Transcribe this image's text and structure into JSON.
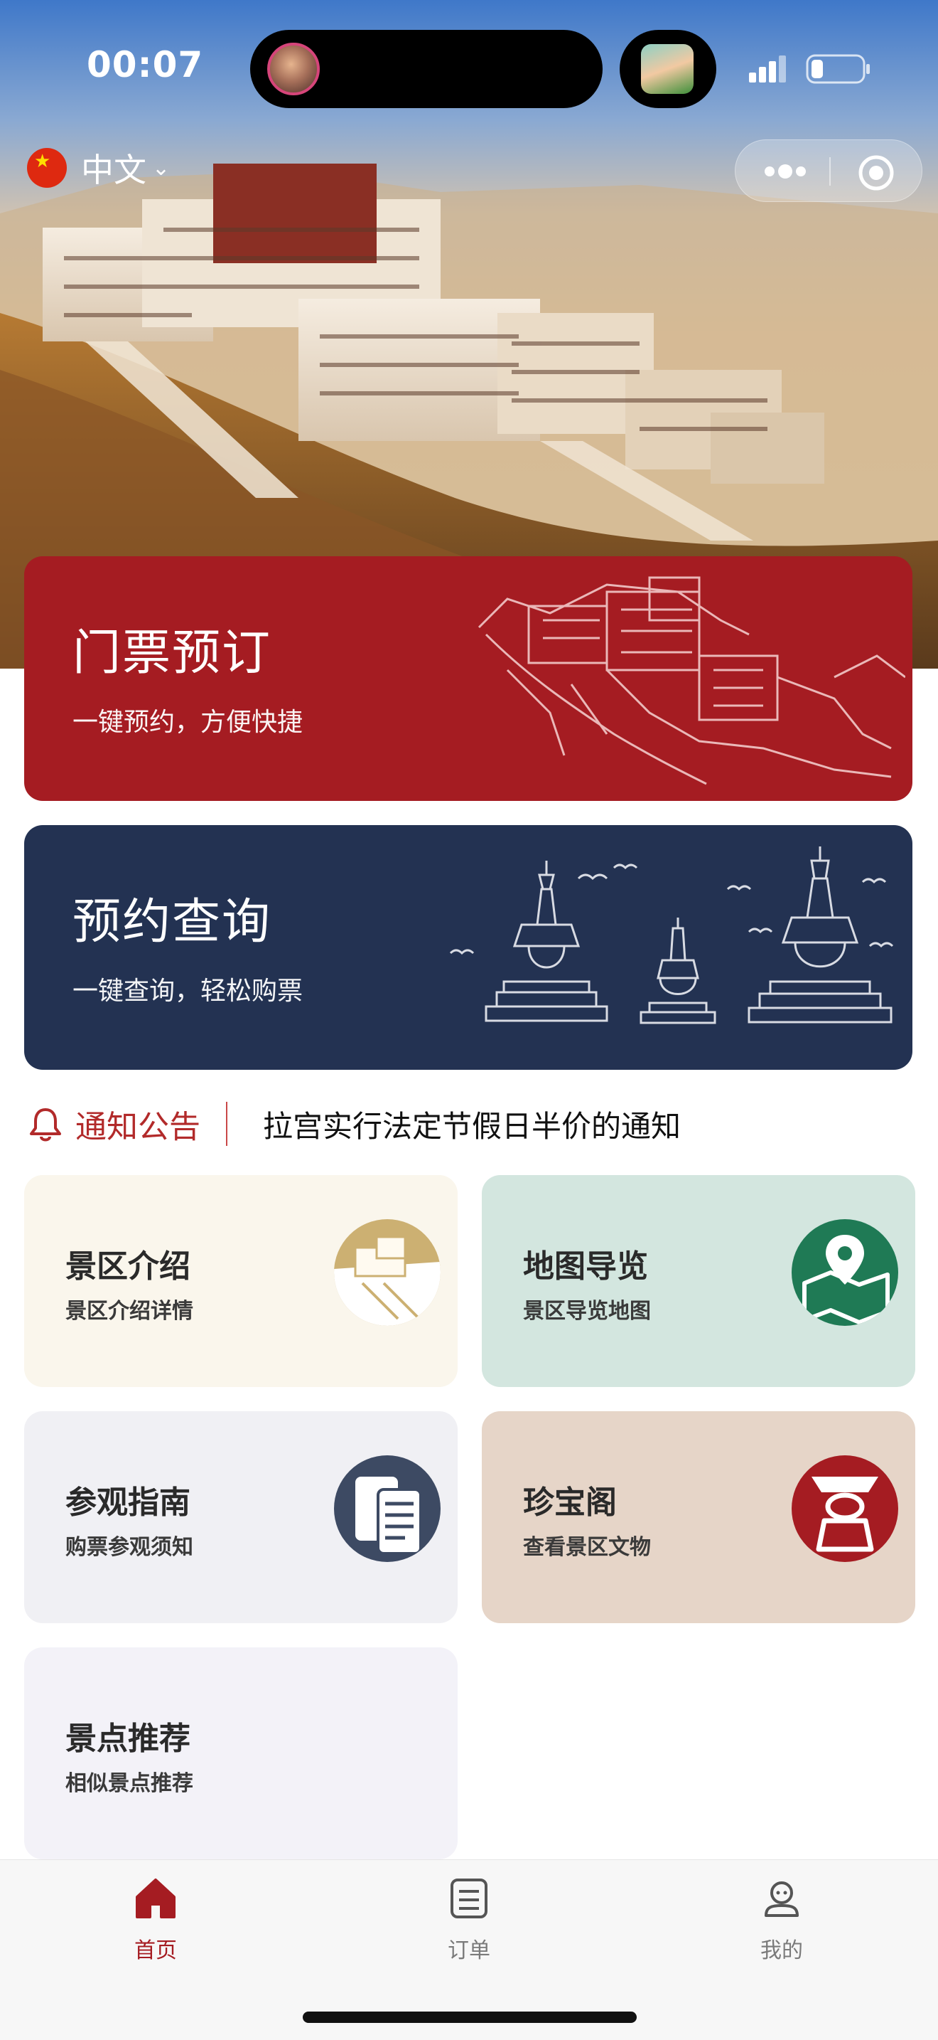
{
  "status_bar": {
    "time": "00:07"
  },
  "header": {
    "language_label": "中文"
  },
  "cards": {
    "ticket": {
      "title": "门票预订",
      "subtitle": "一键预约，方便快捷"
    },
    "query": {
      "title": "预约查询",
      "subtitle": "一键查询，轻松购票"
    }
  },
  "notice": {
    "label": "通知公告",
    "text": "拉宫实行法定节假日半价的通知"
  },
  "grid": [
    {
      "title": "景区介绍",
      "subtitle": "景区介绍详情",
      "icon": "palace-icon"
    },
    {
      "title": "地图导览",
      "subtitle": "景区导览地图",
      "icon": "map-pin-icon"
    },
    {
      "title": "参观指南",
      "subtitle": "购票参观须知",
      "icon": "document-icon"
    },
    {
      "title": "珍宝阁",
      "subtitle": "查看景区文物",
      "icon": "treasure-icon"
    },
    {
      "title": "景点推荐",
      "subtitle": "相似景点推荐"
    }
  ],
  "tabbar": [
    {
      "label": "首页",
      "icon": "home-icon",
      "active": true
    },
    {
      "label": "订单",
      "icon": "order-icon"
    },
    {
      "label": "我的",
      "icon": "profile-icon"
    }
  ],
  "colors": {
    "brand_red": "#a51c22",
    "navy": "#233252"
  }
}
